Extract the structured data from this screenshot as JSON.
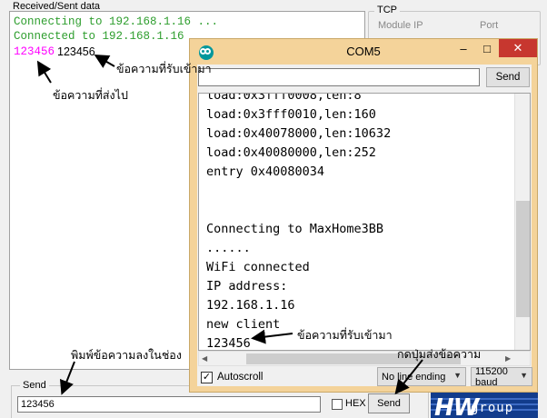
{
  "background_app": {
    "received_sent_title": "Received/Sent data",
    "log_lines": [
      "Connecting to 192.168.1.16 ...",
      "Connected to 192.168.1.16"
    ],
    "sent_text": "123456",
    "received_text": "123456",
    "tcp_group_title": "TCP",
    "tcp_module_ip_label": "Module IP",
    "tcp_port_label": "Port",
    "send_group_title": "Send",
    "send_input_value": "123456",
    "hex_label": "HEX",
    "send_button_label": "Send",
    "logo_text": "HW",
    "logo_subtext": "group"
  },
  "com_window": {
    "title": "COM5",
    "minimize_label": "–",
    "maximize_label": "□",
    "close_label": "✕",
    "input_value": "",
    "send_button_label": "Send",
    "output_lines": [
      "load:0x3fff0008,len:8",
      "load:0x3fff0010,len:160",
      "load:0x40078000,len:10632",
      "load:0x40080000,len:252",
      "entry 0x40080034",
      "",
      "",
      "Connecting to MaxHome3BB",
      "......",
      "WiFi connected",
      "IP address:",
      "192.168.1.16",
      "new client",
      "123456"
    ],
    "autoscroll_label": "Autoscroll",
    "autoscroll_checked": true,
    "line_ending_value": "No line ending",
    "baud_value": "115200 baud"
  },
  "annotations": {
    "received_top": "ข้อความที่รับเข้ามา",
    "sent": "ข้อความที่ส่งไป",
    "received_com": "ข้อความที่รับเข้ามา",
    "type_message": "พิมพ์ข้อความลงในช่อง",
    "press_send": "กดปุ่มส่งข้อความ"
  },
  "colors": {
    "log_green": "#2e9e2e",
    "sent_magenta": "#ff00ff",
    "com_titlebar": "#f4d39a",
    "close_red": "#c7372f",
    "logo_blue": "#123c8c"
  }
}
